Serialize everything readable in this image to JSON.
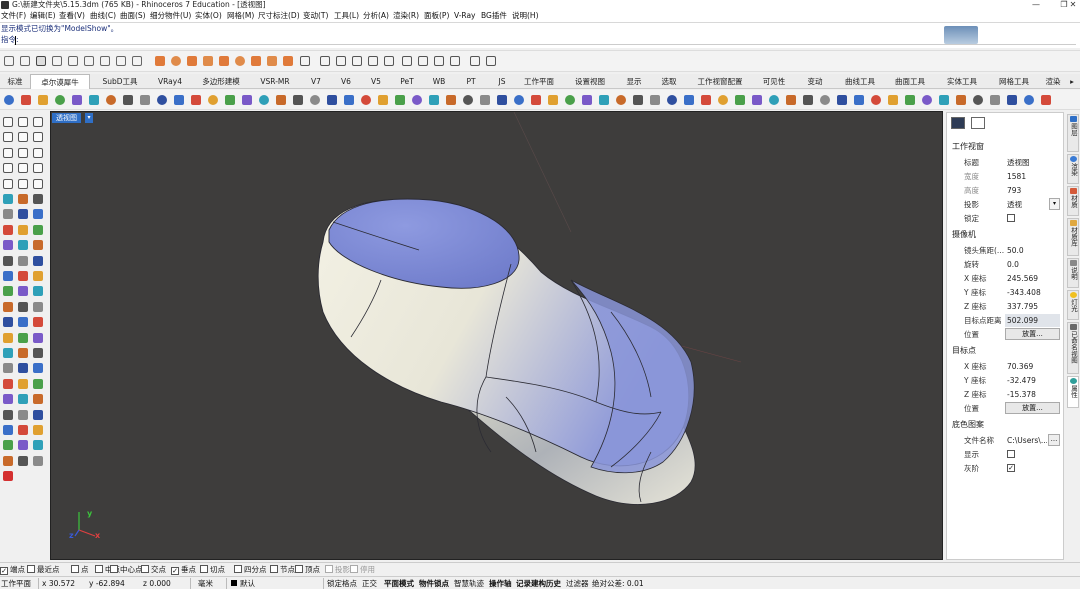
{
  "window": {
    "title": "G:\\新建文件夹\\5.15.3dm (765 KB) - Rhinoceros 7 Education - [透视图]",
    "controls": [
      "—",
      "❐",
      "✕"
    ]
  },
  "menu": [
    "文件(F)",
    "编辑(E)",
    "查看(V)",
    "曲线(C)",
    "曲面(S)",
    "细分物件(U)",
    "实体(O)",
    "网格(M)",
    "尺寸标注(D)",
    "变动(T)",
    "工具(L)",
    "分析(A)",
    "渲染(R)",
    "面板(P)",
    "V-Ray",
    "BG插件",
    "说明(H)"
  ],
  "command": {
    "history": "显示模式已切换为\"ModelShow\"。",
    "prompt": "指令:"
  },
  "tabs": [
    "标准",
    "卓尔谟犀牛",
    "SubD工具",
    "VRay4",
    "多边形建模",
    "VSR-MR",
    "V7",
    "V6",
    "V5",
    "PeT",
    "WB",
    "PT",
    "JS",
    "工作平面",
    "设置视图",
    "显示",
    "选取",
    "工作视窗配置",
    "可见性",
    "变动",
    "曲线工具",
    "曲面工具",
    "实体工具",
    "网格工具",
    "渲染"
  ],
  "active_tab": "卓尔谟犀牛",
  "viewport": {
    "label": "透视图",
    "axes": {
      "x": "x",
      "y": "y",
      "z": "z"
    }
  },
  "properties": {
    "section_viewport": "工作视窗",
    "title_label": "标题",
    "title_value": "透视图",
    "width_label": "宽度",
    "width_value": "1581",
    "height_label": "高度",
    "height_value": "793",
    "projection_label": "投影",
    "projection_value": "透视",
    "lock_label": "锁定",
    "section_camera": "摄像机",
    "lens_label": "镜头焦距(...",
    "lens_value": "50.0",
    "rotation_label": "旋转",
    "rotation_value": "0.0",
    "camx_label": "X 座标",
    "camx_value": "245.569",
    "camy_label": "Y 座标",
    "camy_value": "-343.408",
    "camz_label": "Z 座标",
    "camz_value": "337.795",
    "dist_label": "目标点距离",
    "dist_value": "502.099",
    "pos_label": "位置",
    "place_button": "放置...",
    "section_target": "目标点",
    "tx_label": "X 座标",
    "tx_value": "70.369",
    "ty_label": "Y 座标",
    "ty_value": "-32.479",
    "tz_label": "Z 座标",
    "tz_value": "-15.378",
    "tpos_label": "位置",
    "tplace_button": "放置...",
    "section_bg": "底色图案",
    "file_label": "文件名称",
    "file_value": "C:\\Users\\...",
    "show_label": "显示",
    "gray_label": "灰阶",
    "more_button": "..."
  },
  "right_tabs": [
    "图层",
    "渲染",
    "材质",
    "材质库",
    "说明",
    "灯光",
    "已命名视图",
    "属性"
  ],
  "osnaps": [
    {
      "label": "端点",
      "checked": true
    },
    {
      "label": "最近点",
      "checked": false
    },
    {
      "label": "点",
      "checked": false
    },
    {
      "label": "中点",
      "checked": false
    },
    {
      "label": "中心点",
      "checked": false
    },
    {
      "label": "交点",
      "checked": false
    },
    {
      "label": "垂点",
      "checked": true
    },
    {
      "label": "切点",
      "checked": false
    },
    {
      "label": "四分点",
      "checked": false
    },
    {
      "label": "节点",
      "checked": false
    },
    {
      "label": "顶点",
      "checked": false
    },
    {
      "label": "投影",
      "checked": false,
      "disabled": true
    },
    {
      "label": "停用",
      "checked": false,
      "disabled": true
    }
  ],
  "status": {
    "cplane": "工作平面",
    "x": "x 30.572",
    "y": "y -62.894",
    "z": "z 0.000",
    "units": "毫米",
    "layer": "默认",
    "grid_snap": "锁定格点",
    "ortho": "正交",
    "planar": "平面模式",
    "osnap": "物件锁点",
    "smarttrack": "智慧轨迹",
    "gumball": "操作轴",
    "history": "记录建构历史",
    "filter": "过滤器",
    "tolerance": "绝对公差: 0.01"
  },
  "colors": {
    "viewport_bg": "#3e3d3c",
    "viewport_label": "#2f6fc6",
    "model_top": "#7a88d6",
    "model_side": "#e8e6d6"
  }
}
